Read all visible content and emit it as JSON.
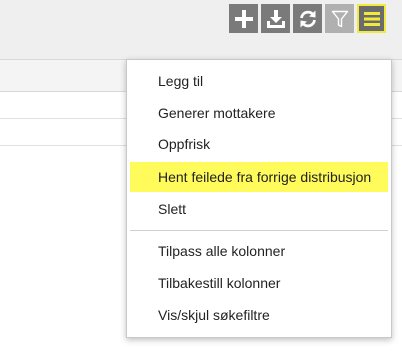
{
  "toolbar": {
    "buttons": [
      {
        "icon": "plus-icon",
        "state": "normal"
      },
      {
        "icon": "download-icon",
        "state": "normal"
      },
      {
        "icon": "refresh-icon",
        "state": "normal"
      },
      {
        "icon": "filter-icon",
        "state": "disabled"
      },
      {
        "icon": "menu-icon",
        "state": "active"
      }
    ]
  },
  "menu": {
    "items": [
      {
        "label": "Legg til"
      },
      {
        "label": "Generer mottakere"
      },
      {
        "label": "Oppfrisk"
      },
      {
        "label": "Hent feilede fra forrige distribusjon",
        "highlighted": true
      },
      {
        "label": "Slett"
      },
      {
        "label": "Tilpass alle kolonner"
      },
      {
        "label": "Tilbakestill kolonner"
      },
      {
        "label": "Vis/skjul søkefiltre"
      }
    ]
  },
  "colors": {
    "highlight": "#fffb5a",
    "button_bg": "#7a7a7a",
    "button_disabled": "#b0b0b0",
    "active_border": "#f0ea3c"
  }
}
